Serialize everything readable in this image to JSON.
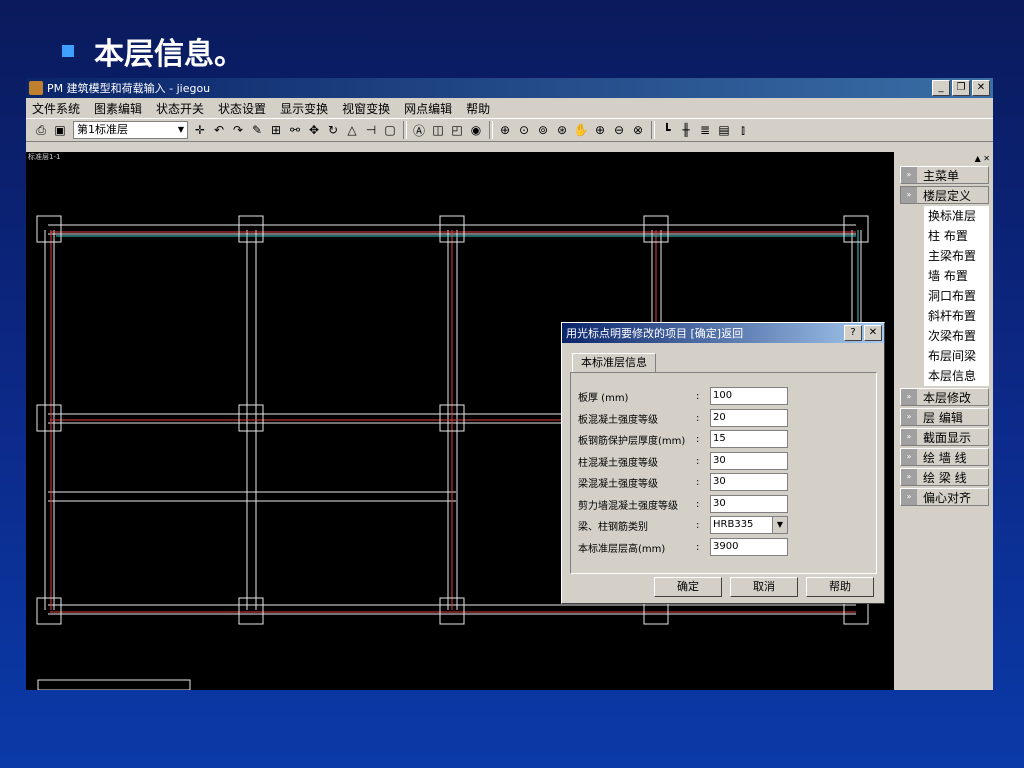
{
  "slide": {
    "title": "本层信息。"
  },
  "window": {
    "title": "PM 建筑模型和荷载输入 - jiegou"
  },
  "menu": [
    "文件系统",
    "图素编辑",
    "状态开关",
    "状态设置",
    "显示变换",
    "视窗变换",
    "网点编辑",
    "帮助"
  ],
  "toolbar": {
    "layer_select": "第1标准层"
  },
  "canvas": {
    "corner_tag": "标准层1-1"
  },
  "right_panel": {
    "sections_top": [
      "主菜单",
      "楼层定义"
    ],
    "sub_items": [
      "换标准层",
      "柱 布置",
      "主梁布置",
      "墙 布置",
      "洞口布置",
      "斜杆布置",
      "次梁布置",
      "布层间梁",
      "本层信息"
    ],
    "sections_bottom": [
      "本层修改",
      "层 编辑",
      "截面显示",
      "绘 墙 线",
      "绘 梁 线",
      "偏心对齐"
    ]
  },
  "dialog": {
    "title": "用光标点明要修改的项目 [确定]返回",
    "tab": "本标准层信息",
    "fields": [
      {
        "label": "板厚 (mm)",
        "value": "100"
      },
      {
        "label": "板混凝土强度等级",
        "value": "20"
      },
      {
        "label": "板钢筋保护层厚度(mm)",
        "value": "15"
      },
      {
        "label": "柱混凝土强度等级",
        "value": "30"
      },
      {
        "label": "梁混凝土强度等级",
        "value": "30"
      },
      {
        "label": "剪力墙混凝土强度等级",
        "value": "30"
      },
      {
        "label": "梁、柱钢筋类别",
        "value": "HRB335"
      },
      {
        "label": "本标准层层高(mm)",
        "value": "3900"
      }
    ],
    "buttons": {
      "ok": "确定",
      "cancel": "取消",
      "help": "帮助"
    }
  }
}
